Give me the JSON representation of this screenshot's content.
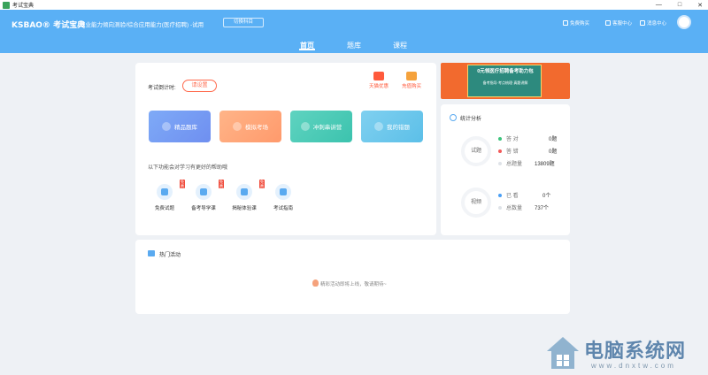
{
  "window": {
    "title": "考试宝典"
  },
  "header": {
    "logo": "KSBAO® 考试宝典",
    "subject": "职业能力倾向测验/综合应用能力(医疗招聘) -试用",
    "switch_label": "切换科目",
    "links": [
      "免费购买",
      "客服中心",
      "消息中心"
    ]
  },
  "nav": {
    "tabs": [
      "首页",
      "题库",
      "课程"
    ],
    "active": "首页"
  },
  "main": {
    "countdown_label": "考试倒计时:",
    "remind_label": "请设置",
    "shop_items": [
      "天猫优惠",
      "充值购买"
    ],
    "tiles": [
      "精品题库",
      "模拟考场",
      "冲刺串讲营",
      "我的错题"
    ],
    "help_text": "以下功能会对学习有更好的帮助哦",
    "tools": [
      {
        "label": "免费试题",
        "badge": "免费"
      },
      {
        "label": "备考导学课",
        "badge": "免费"
      },
      {
        "label": "揭秘体验课",
        "badge": "免费"
      },
      {
        "label": "考试指南",
        "badge": ""
      }
    ]
  },
  "banner": {
    "text": "0元领医疗招聘备考助力包",
    "sub": "备考指导·考点梳理·真题讲解"
  },
  "stats": {
    "title": "统计分析",
    "questions": {
      "label": "试题",
      "rows": [
        {
          "label": "答 对",
          "value": "0题",
          "color": "#3cc47c"
        },
        {
          "label": "答 错",
          "value": "0题",
          "color": "#f25a5a"
        },
        {
          "label": "总题量",
          "value": "13809题",
          "color": "#dfe3e8"
        }
      ]
    },
    "videos": {
      "label": "视频",
      "rows": [
        {
          "label": "已 看",
          "value": "0个",
          "color": "#4a9ff5"
        },
        {
          "label": "总数量",
          "value": "737个",
          "color": "#dfe3e8"
        }
      ]
    }
  },
  "activities": {
    "title": "热门活动",
    "empty_text": "精彩活动即将上线，敬请期待~"
  },
  "watermark": {
    "name": "电脑系统网",
    "url": "www.dnxtw.com"
  }
}
